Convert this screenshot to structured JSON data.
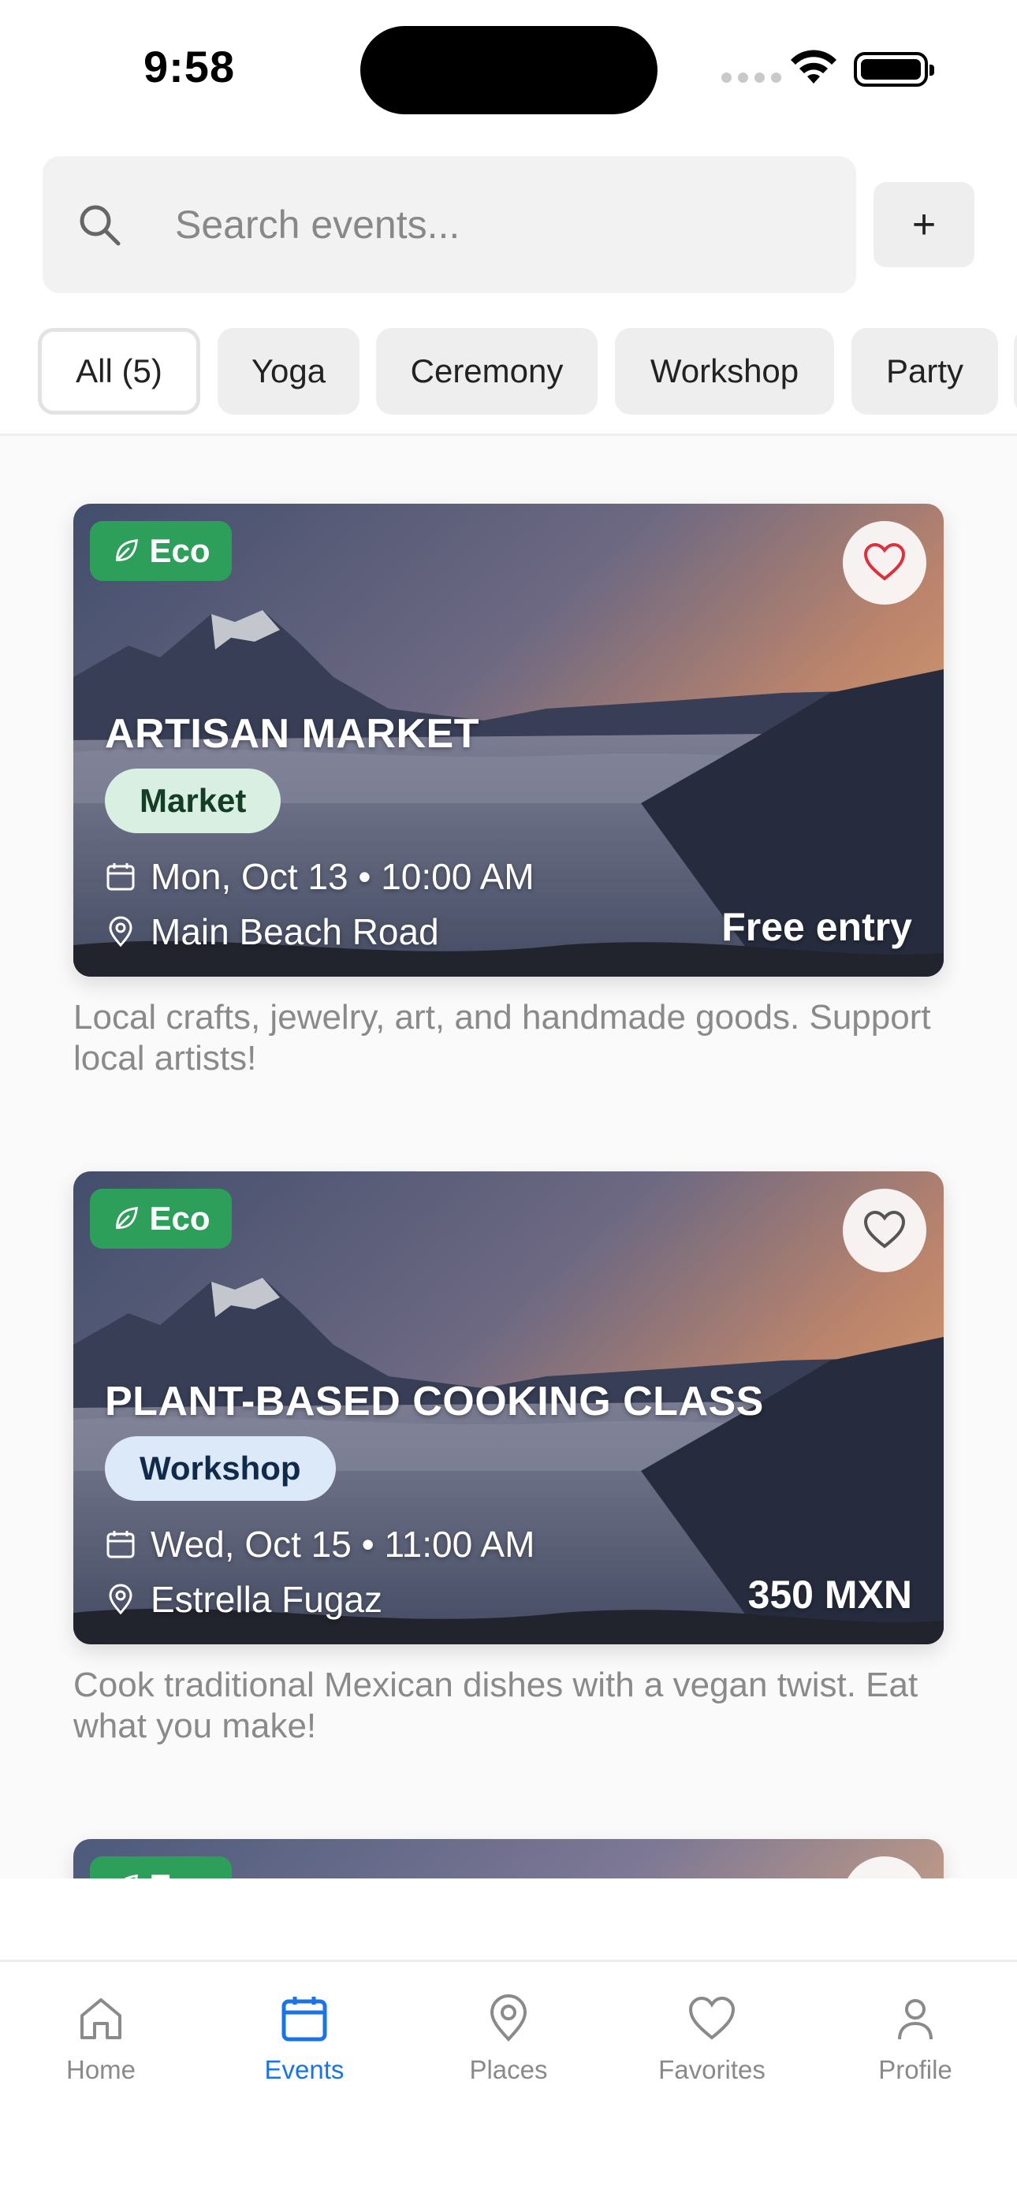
{
  "status_bar": {
    "time": "9:58"
  },
  "search": {
    "placeholder": "Search events...",
    "add_label": "+"
  },
  "filters": [
    {
      "label": "All (5)",
      "active": true
    },
    {
      "label": "Yoga",
      "active": false
    },
    {
      "label": "Ceremony",
      "active": false
    },
    {
      "label": "Workshop",
      "active": false
    },
    {
      "label": "Party",
      "active": false
    }
  ],
  "events": [
    {
      "badge": "Eco",
      "title": "ARTISAN MARKET",
      "category": "Market",
      "datetime": "Mon, Oct 13 • 10:00 AM",
      "location": "Main Beach Road",
      "price": "Free entry",
      "favorited": true,
      "description": "Local crafts, jewelry, art, and handmade goods. Support local artists!"
    },
    {
      "badge": "Eco",
      "title": "PLANT-BASED COOKING CLASS",
      "category": "Workshop",
      "datetime": "Wed, Oct 15 • 11:00 AM",
      "location": "Estrella Fugaz",
      "price": "350 MXN",
      "favorited": false,
      "description": "Cook traditional Mexican dishes with a vegan twist. Eat what you make!"
    },
    {
      "badge": "Eco"
    }
  ],
  "tabs": [
    {
      "label": "Home",
      "icon": "home-icon",
      "active": false
    },
    {
      "label": "Events",
      "icon": "calendar-icon",
      "active": true
    },
    {
      "label": "Places",
      "icon": "map-pin-icon",
      "active": false
    },
    {
      "label": "Favorites",
      "icon": "heart-icon",
      "active": false
    },
    {
      "label": "Profile",
      "icon": "user-icon",
      "active": false
    }
  ],
  "colors": {
    "accent": "#1a73e8",
    "eco_badge": "#2e9e5b",
    "market_chip": "#d9efe1",
    "workshop_chip": "#dce9f8",
    "favorite": "#e0303c"
  }
}
